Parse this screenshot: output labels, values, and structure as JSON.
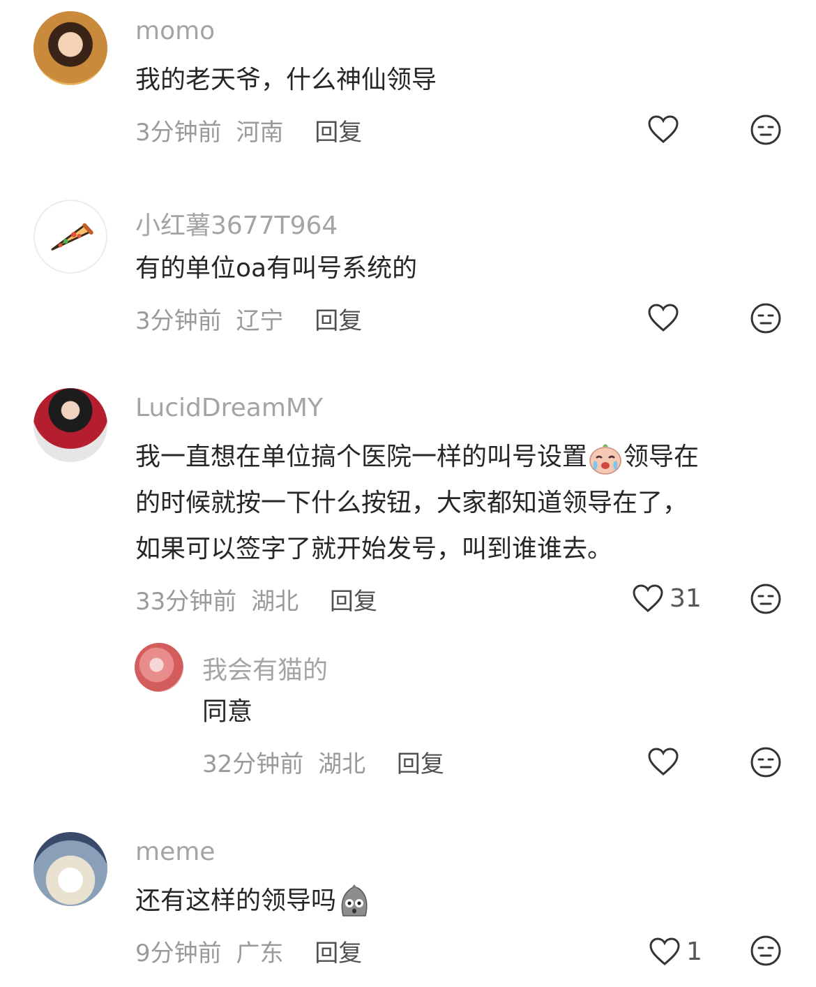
{
  "comments": [
    {
      "username": "momo",
      "lines": [
        "我的老天爷，什么神仙领导"
      ],
      "time": "3分钟前",
      "location": "河南",
      "reply_label": "回复",
      "like_count": ""
    },
    {
      "username": "小红薯3677T964",
      "lines": [
        "有的单位oa有叫号系统的"
      ],
      "time": "3分钟前",
      "location": "辽宁",
      "reply_label": "回复",
      "like_count": ""
    },
    {
      "username": "LucidDreamMY",
      "lines": [
        "我一直想在单位搞个医院一样的叫号设置",
        "领导在",
        "的时候就按一下什么按钮，大家都知道领导在了，",
        "如果可以签字了就开始发号，叫到谁谁去。"
      ],
      "time": "33分钟前",
      "location": "湖北",
      "reply_label": "回复",
      "like_count": "31"
    },
    {
      "username": "我会有猫的",
      "lines": [
        "同意"
      ],
      "time": "32分钟前",
      "location": "湖北",
      "reply_label": "回复",
      "like_count": ""
    },
    {
      "username": "meme",
      "lines": [
        "还有这样的领导吗"
      ],
      "time": "9分钟前",
      "location": "广东",
      "reply_label": "回复",
      "like_count": "1"
    }
  ],
  "icons": {
    "like": "heart-outline-icon",
    "dislike": "neutral-face-icon",
    "emoji_cry": "crying-face-emoji",
    "emoji_shock": "shocked-face-emoji"
  }
}
